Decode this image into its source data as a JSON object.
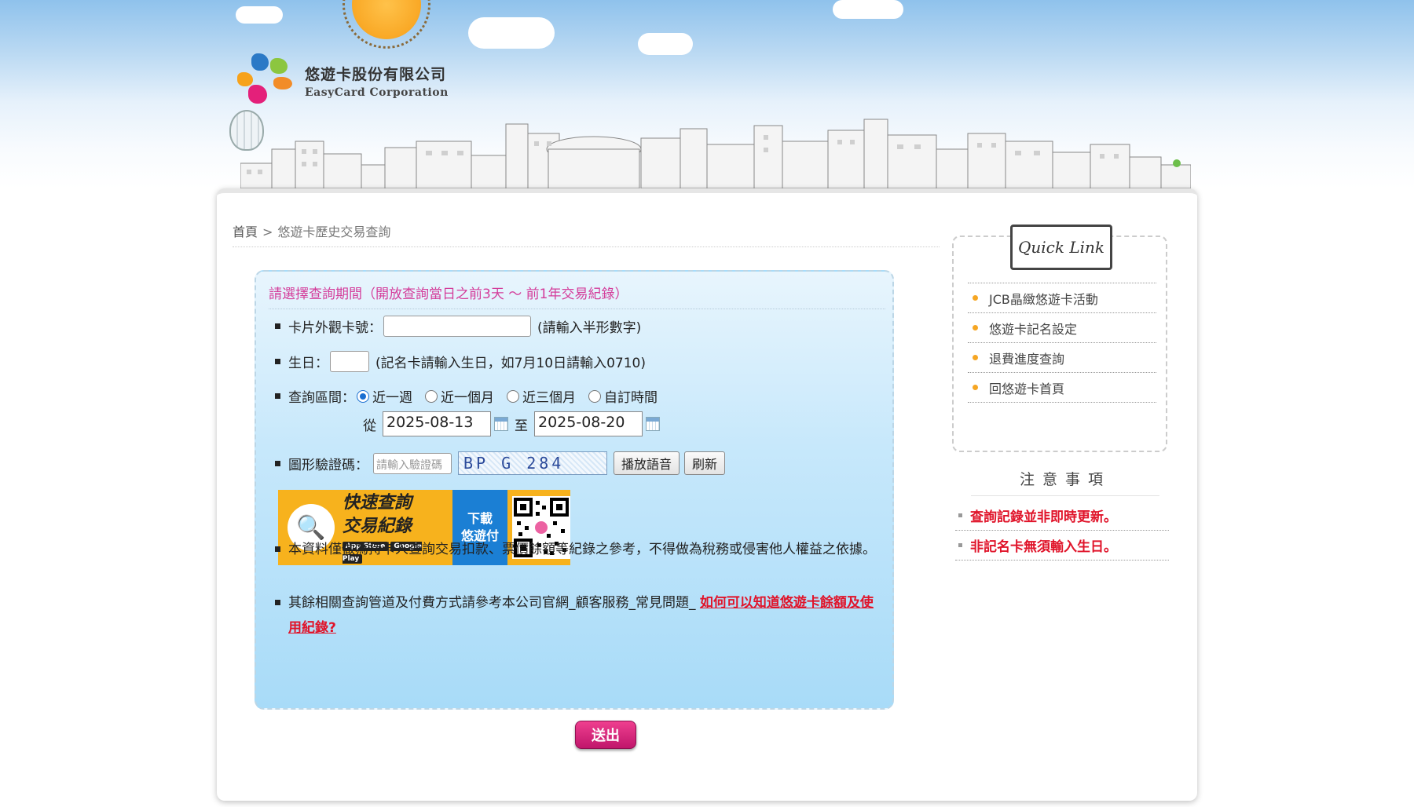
{
  "header": {
    "company_zh": "悠遊卡股份有限公司",
    "company_en": "EasyCard Corporation"
  },
  "breadcrumb": {
    "home": "首頁",
    "separator": ">",
    "current": "悠遊卡歷史交易查詢"
  },
  "form": {
    "title": "請選擇查詢期間（開放查詢當日之前3天 ～ 前1年交易紀錄）",
    "card_label": "卡片外觀卡號：",
    "card_value": "",
    "card_hint": "(請輸入半形數字)",
    "birthday_label": "生日：",
    "birthday_value": "",
    "birthday_hint": "(記名卡請輸入生日，如7月10日請輸入0710)",
    "range_label": "查詢區間：",
    "range_options": [
      "近一週",
      "近一個月",
      "近三個月",
      "自訂時間"
    ],
    "range_selected": "近一週",
    "from_label": "從",
    "from_date": "2025-08-13",
    "to_label": "至",
    "to_date": "2025-08-20",
    "captcha_label": "圖形驗證碼：",
    "captcha_placeholder": "請輸入驗證碼",
    "captcha_image_text": "BP G 284",
    "play_audio_label": "播放語音",
    "refresh_label": "刷新",
    "submit_label": "送出"
  },
  "banner": {
    "line1": "快速查詢",
    "line2": "交易紀錄",
    "store1": "App Store",
    "store2": "Google Play",
    "download_line1": "下載",
    "download_line2": "悠遊付"
  },
  "notes": {
    "note1": "本資料僅做為持卡人查詢交易扣款、票價餘額等紀錄之參考，不得做為稅務或侵害他人權益之依據。",
    "note2_prefix": "其餘相關查詢管道及付費方式請參考本公司官網_顧客服務_常見問題_",
    "note2_link": "如何可以知道悠遊卡餘額及使用紀錄?"
  },
  "quick_link": {
    "title": "Quick Link",
    "items": [
      "JCB晶緻悠遊卡活動",
      "悠遊卡記名設定",
      "退費進度查詢",
      "回悠遊卡首頁"
    ]
  },
  "notice": {
    "title": "注意事項",
    "items": [
      "查詢記錄並非即時更新。",
      "非記名卡無須輸入生日。"
    ]
  },
  "colors": {
    "accent_pink": "#d43c9a",
    "link_red": "#e0142a",
    "bullet_orange": "#f6a623",
    "panel_blue": "#a8dbf8"
  }
}
